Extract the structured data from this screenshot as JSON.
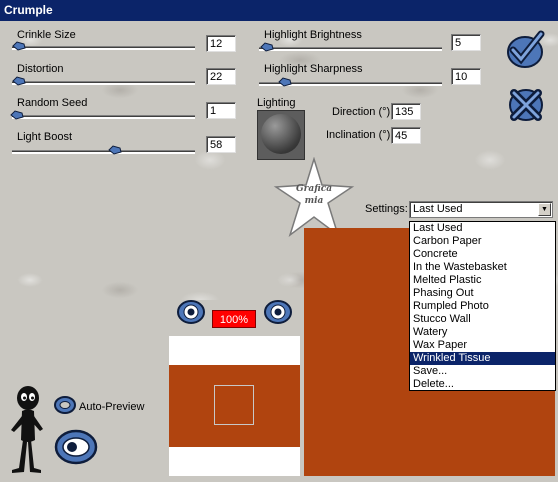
{
  "title": "Crumple",
  "sliders_left": [
    {
      "label": "Crinkle Size",
      "value": "12",
      "level": 0.02
    },
    {
      "label": "Distortion",
      "value": "22",
      "level": 0.02
    },
    {
      "label": "Random Seed",
      "value": "1",
      "level": 0.0
    },
    {
      "label": "Light Boost",
      "value": "58",
      "level": 0.55
    }
  ],
  "sliders_right": [
    {
      "label": "Highlight Brightness",
      "value": "5",
      "level": 0.02
    },
    {
      "label": "Highlight Sharpness",
      "value": "10",
      "level": 0.1
    }
  ],
  "lighting": {
    "label": "Lighting",
    "direction_label": "Direction (°)",
    "direction_value": "135",
    "inclination_label": "Inclination (°)",
    "inclination_value": "45"
  },
  "logo": {
    "line1": "Grafica",
    "line2": "mia"
  },
  "settings": {
    "label": "Settings:",
    "selected": "Last Used",
    "options": [
      "Last Used",
      "Carbon Paper",
      "Concrete",
      "In the Wastebasket",
      "Melted Plastic",
      "Phasing Out",
      "Rumpled Photo",
      "Stucco Wall",
      "Watery",
      "Wax Paper",
      "Wrinkled Tissue",
      "Save...",
      "Delete..."
    ],
    "highlighted": "Wrinkled Tissue"
  },
  "zoom": "100%",
  "auto_preview": "Auto-Preview",
  "colors": {
    "preview": "#b0440f",
    "titlebar": "#0b2469",
    "zoom_badge": "#ff0000",
    "icon_blue": "#4d76b8"
  }
}
